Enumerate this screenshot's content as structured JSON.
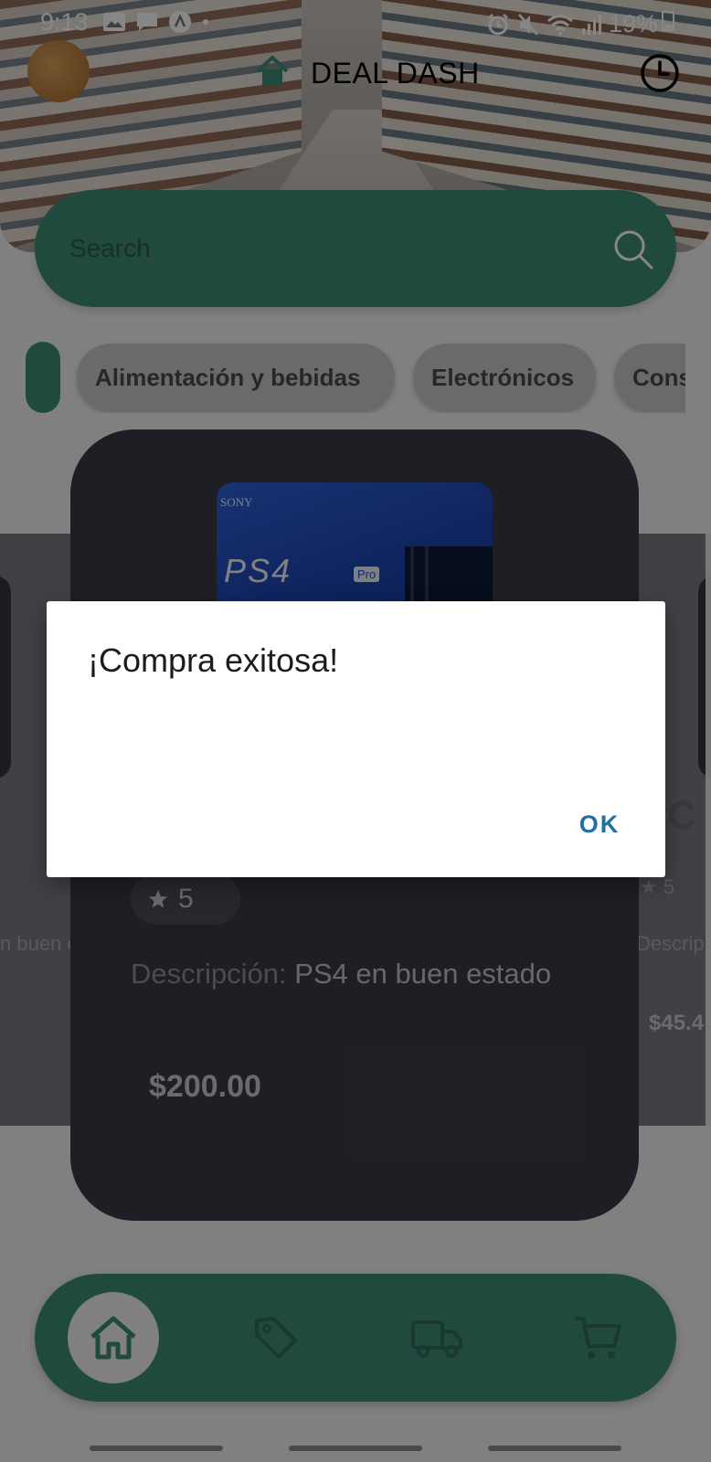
{
  "status_bar": {
    "time": "9:13",
    "battery": "19%",
    "left_icons": [
      "image-icon",
      "message-icon",
      "app-icon",
      "dot-icon"
    ],
    "right_icons": [
      "alarm-icon",
      "mute-icon",
      "wifi-icon",
      "signal-icon",
      "battery-icon"
    ]
  },
  "header": {
    "title": "DEAL DASH",
    "home_icon": "home-icon",
    "history_icon": "clock-icon"
  },
  "search": {
    "placeholder": "Search"
  },
  "categories": {
    "items": [
      "Alimentación y bebidas",
      "Electrónicos",
      "Cons"
    ]
  },
  "product": {
    "image_box_text": "SONY",
    "image_logo_text": "PS4",
    "image_badge": "Pro",
    "rating": "5",
    "description_label": "Descripción:",
    "description_value": "PS4 en buen estado",
    "price": "$200.00"
  },
  "side_cards": {
    "left_partial_text": "n buen e",
    "right_partial_title": "C I",
    "right_partial_rating": "5",
    "right_partial_desc": "Descrip",
    "right_partial_price": "$45.4"
  },
  "dialog": {
    "title": "¡Compra exitosa!",
    "ok_label": "OK"
  },
  "bottom_nav": {
    "items": [
      "home-icon",
      "tag-icon",
      "truck-icon",
      "cart-icon"
    ]
  },
  "colors": {
    "accent": "#3f8c78",
    "dialog_button": "#1f6fa8",
    "card": "#3a3c47"
  }
}
